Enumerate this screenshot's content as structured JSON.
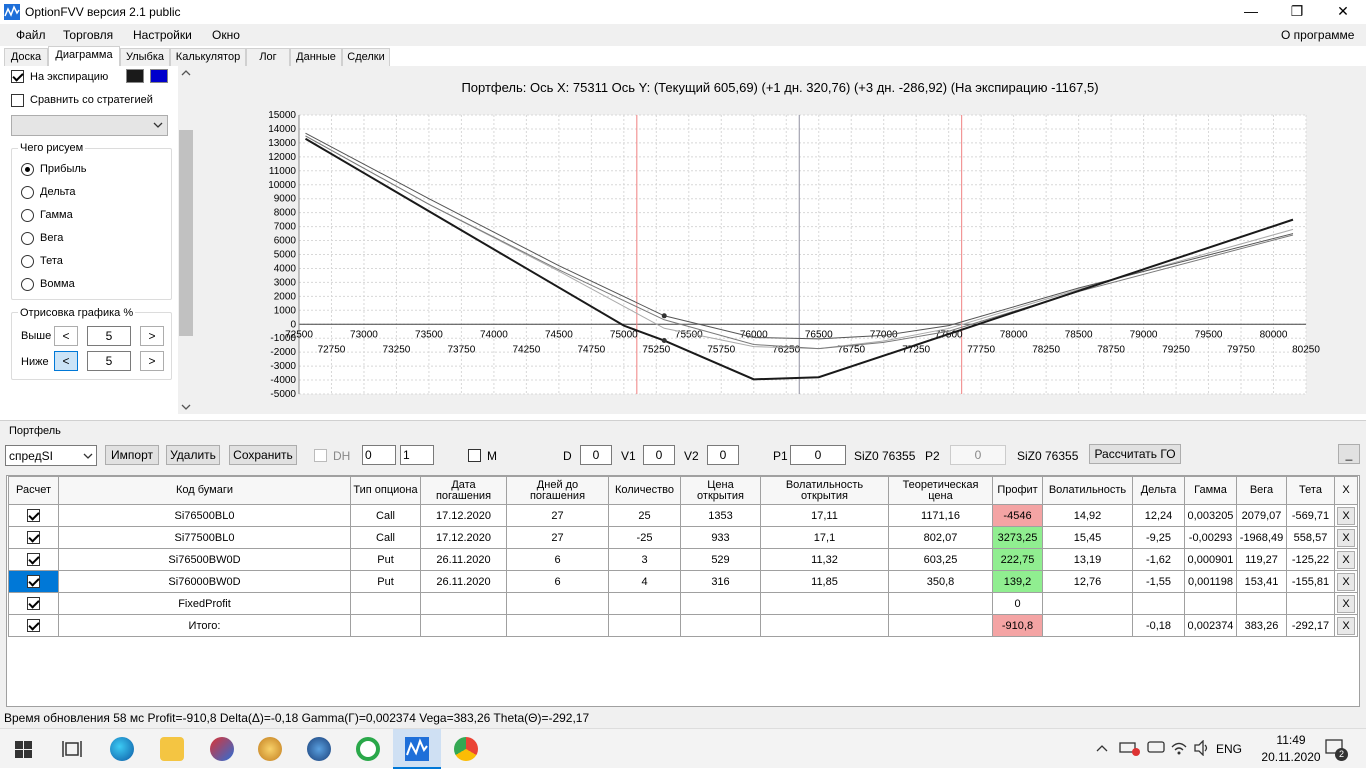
{
  "window": {
    "title": "OptionFVV версия 2.1 public",
    "minimize": "—",
    "maximize": "❐",
    "close": "✕"
  },
  "menu": {
    "items": [
      "Файл",
      "Торговля",
      "Настройки",
      "Окно"
    ],
    "about": "О программе"
  },
  "tabs": [
    "Доска",
    "Диаграмма",
    "Улыбка",
    "Калькулятор",
    "Лог",
    "Данные",
    "Сделки"
  ],
  "active_tab": "Диаграмма",
  "left_panel": {
    "expiry_label": "На экспирацию",
    "expiry_checked": true,
    "compare_label": "Сравнить со стратегией",
    "compare_checked": false,
    "swatch_colors": [
      "#1a1a1a",
      "#0000cc"
    ],
    "what_draw_title": "Чего рисуем",
    "radio_options": [
      "Прибыль",
      "Дельта",
      "Гамма",
      "Вега",
      "Тета",
      "Вомма"
    ],
    "radio_selected": "Прибыль",
    "draw_group_title": "Отрисовка графика %",
    "above_label": "Выше",
    "above_value": "5",
    "below_label": "Ниже",
    "below_value": "5",
    "dec": "<",
    "inc": ">"
  },
  "chart_header": {
    "text": "Портфель: Ось X: 75311 Ось Y:  (Текущий 605,69)  (+1 дн. 320,76)  (+3 дн. -286,92)  (На экспирацию -1167,5)"
  },
  "chart_data": {
    "type": "line",
    "xlim": [
      72500,
      80250
    ],
    "ylim": [
      -5000,
      15000
    ],
    "x_ticks_top": [
      "72500",
      "73000",
      "73500",
      "74000",
      "74500",
      "75000",
      "75500",
      "76000",
      "76500",
      "77000",
      "77500",
      "78000",
      "78500",
      "79000",
      "79500",
      "80000"
    ],
    "x_ticks_bottom": [
      "72750",
      "73250",
      "73750",
      "74250",
      "74750",
      "75250",
      "75750",
      "76250",
      "76750",
      "77250",
      "77750",
      "78250",
      "78750",
      "79250",
      "79750",
      "80250"
    ],
    "y_ticks": [
      "15000",
      "14000",
      "13000",
      "12000",
      "11000",
      "10000",
      "9000",
      "8000",
      "7000",
      "6000",
      "5000",
      "4000",
      "3000",
      "2000",
      "1000",
      "0",
      "-1000",
      "-2000",
      "-3000",
      "-4000",
      "-5000"
    ],
    "vlines": [
      {
        "x": 75100,
        "color": "#f08080"
      },
      {
        "x": 76350,
        "color": "#9090a0"
      },
      {
        "x": 77600,
        "color": "#f08080"
      }
    ],
    "series": [
      {
        "color": "#1a1a1a",
        "width": 2,
        "x": [
          72550,
          75000,
          75311,
          76000,
          76500,
          80150
        ],
        "y": [
          13300,
          -100,
          -1167,
          -3950,
          -3800,
          7500
        ]
      },
      {
        "color": "#555555",
        "width": 1,
        "x": [
          72550,
          73500,
          74500,
          75311,
          76000,
          76500,
          77000,
          77500,
          78500,
          80150
        ],
        "y": [
          13700,
          9000,
          4200,
          606,
          -950,
          -1050,
          -800,
          -100,
          2600,
          6500
        ]
      },
      {
        "color": "#7a7a7a",
        "width": 1,
        "x": [
          72550,
          73500,
          74500,
          75311,
          76000,
          76500,
          77000,
          77500,
          78500,
          80150
        ],
        "y": [
          13500,
          8600,
          3900,
          321,
          -1450,
          -1750,
          -1300,
          -500,
          2350,
          6400
        ]
      },
      {
        "color": "#aaaaaa",
        "width": 1,
        "x": [
          72550,
          73500,
          74500,
          75311,
          76000,
          76500,
          77000,
          77500,
          78500,
          80150
        ],
        "y": [
          13500,
          8600,
          3800,
          -287,
          -1600,
          -1750,
          -1200,
          -300,
          2500,
          6800
        ]
      }
    ],
    "markers": [
      {
        "x": 75311,
        "y": 606
      },
      {
        "x": 75311,
        "y": -1167
      }
    ]
  },
  "portfolio": {
    "title": "Портфель",
    "portfolio_name": "спредSI",
    "import_btn": "Импорт",
    "delete_btn": "Удалить",
    "save_btn": "Сохранить",
    "dh_label": "DH",
    "spin1": "0",
    "spin2": "1",
    "m_label": "M",
    "d_label": "D",
    "d_value": "0",
    "v1_label": "V1",
    "v1_value": "0",
    "v2_label": "V2",
    "v2_value": "0",
    "p1_label": "P1",
    "p1_value": "0",
    "siz1": "SiZ0 76355",
    "p2_label": "P2",
    "p2_value": "0",
    "siz2": "SiZ0 76355",
    "calc_go_btn": "Рассчитать ГО",
    "collapse_btn": "_"
  },
  "table": {
    "headers": [
      "Расчет",
      "Код бумаги",
      "Тип опциона",
      "Дата погашения",
      "Дней до погашения",
      "Количество",
      "Цена открытия",
      "Волатильность открытия",
      "Теоретическая цена",
      "Профит",
      "Волатильность",
      "Дельта",
      "Гамма",
      "Вега",
      "Тета",
      "X"
    ],
    "rows": [
      {
        "code": "Si76500BL0",
        "type": "Call",
        "date": "17.12.2020",
        "days": "27",
        "qty": "25",
        "open": "1353",
        "vol_open": "17,11",
        "theor": "1171,16",
        "profit": "-4546",
        "profit_state": "neg",
        "vol": "14,92",
        "delta": "12,24",
        "gamma": "0,003205",
        "vega": "2079,07",
        "theta": "-569,71",
        "x": "X"
      },
      {
        "code": "Si77500BL0",
        "type": "Call",
        "date": "17.12.2020",
        "days": "27",
        "qty": "-25",
        "open": "933",
        "vol_open": "17,1",
        "theor": "802,07",
        "profit": "3273,25",
        "profit_state": "pos",
        "vol": "15,45",
        "delta": "-9,25",
        "gamma": "-0,00293",
        "vega": "-1968,49",
        "theta": "558,57",
        "x": "X"
      },
      {
        "code": "Si76500BW0D",
        "type": "Put",
        "date": "26.11.2020",
        "days": "6",
        "qty": "3",
        "open": "529",
        "vol_open": "11,32",
        "theor": "603,25",
        "profit": "222,75",
        "profit_state": "pos",
        "vol": "13,19",
        "delta": "-1,62",
        "gamma": "0,000901",
        "vega": "119,27",
        "theta": "-125,22",
        "x": "X"
      },
      {
        "code": "Si76000BW0D",
        "type": "Put",
        "date": "26.11.2020",
        "days": "6",
        "qty": "4",
        "open": "316",
        "vol_open": "11,85",
        "theor": "350,8",
        "profit": "139,2",
        "profit_state": "pos",
        "vol": "12,76",
        "delta": "-1,55",
        "gamma": "0,001198",
        "vega": "153,41",
        "theta": "-155,81",
        "x": "X"
      },
      {
        "code": "FixedProfit",
        "type": "",
        "date": "",
        "days": "",
        "qty": "",
        "open": "",
        "vol_open": "",
        "theor": "",
        "profit": "0",
        "profit_state": "",
        "vol": "",
        "delta": "",
        "gamma": "",
        "vega": "",
        "theta": "",
        "x": "X"
      },
      {
        "code": "Итого:",
        "type": "",
        "date": "",
        "days": "",
        "qty": "",
        "open": "",
        "vol_open": "",
        "theor": "",
        "profit": "-910,8",
        "profit_state": "neg",
        "vol": "",
        "delta": "-0,18",
        "gamma": "0,002374",
        "vega": "383,26",
        "theta": "-292,17",
        "x": "X"
      }
    ]
  },
  "status": {
    "text": "Время обновления 58 мс  Profit=-910,8 Delta(Δ)=-0,18 Gamma(Γ)=0,002374 Vega=383,26 Theta(Θ)=-292,17"
  },
  "taskbar": {
    "lang": "ENG",
    "time": "11:49",
    "date": "20.11.2020",
    "notif_count": "2"
  }
}
